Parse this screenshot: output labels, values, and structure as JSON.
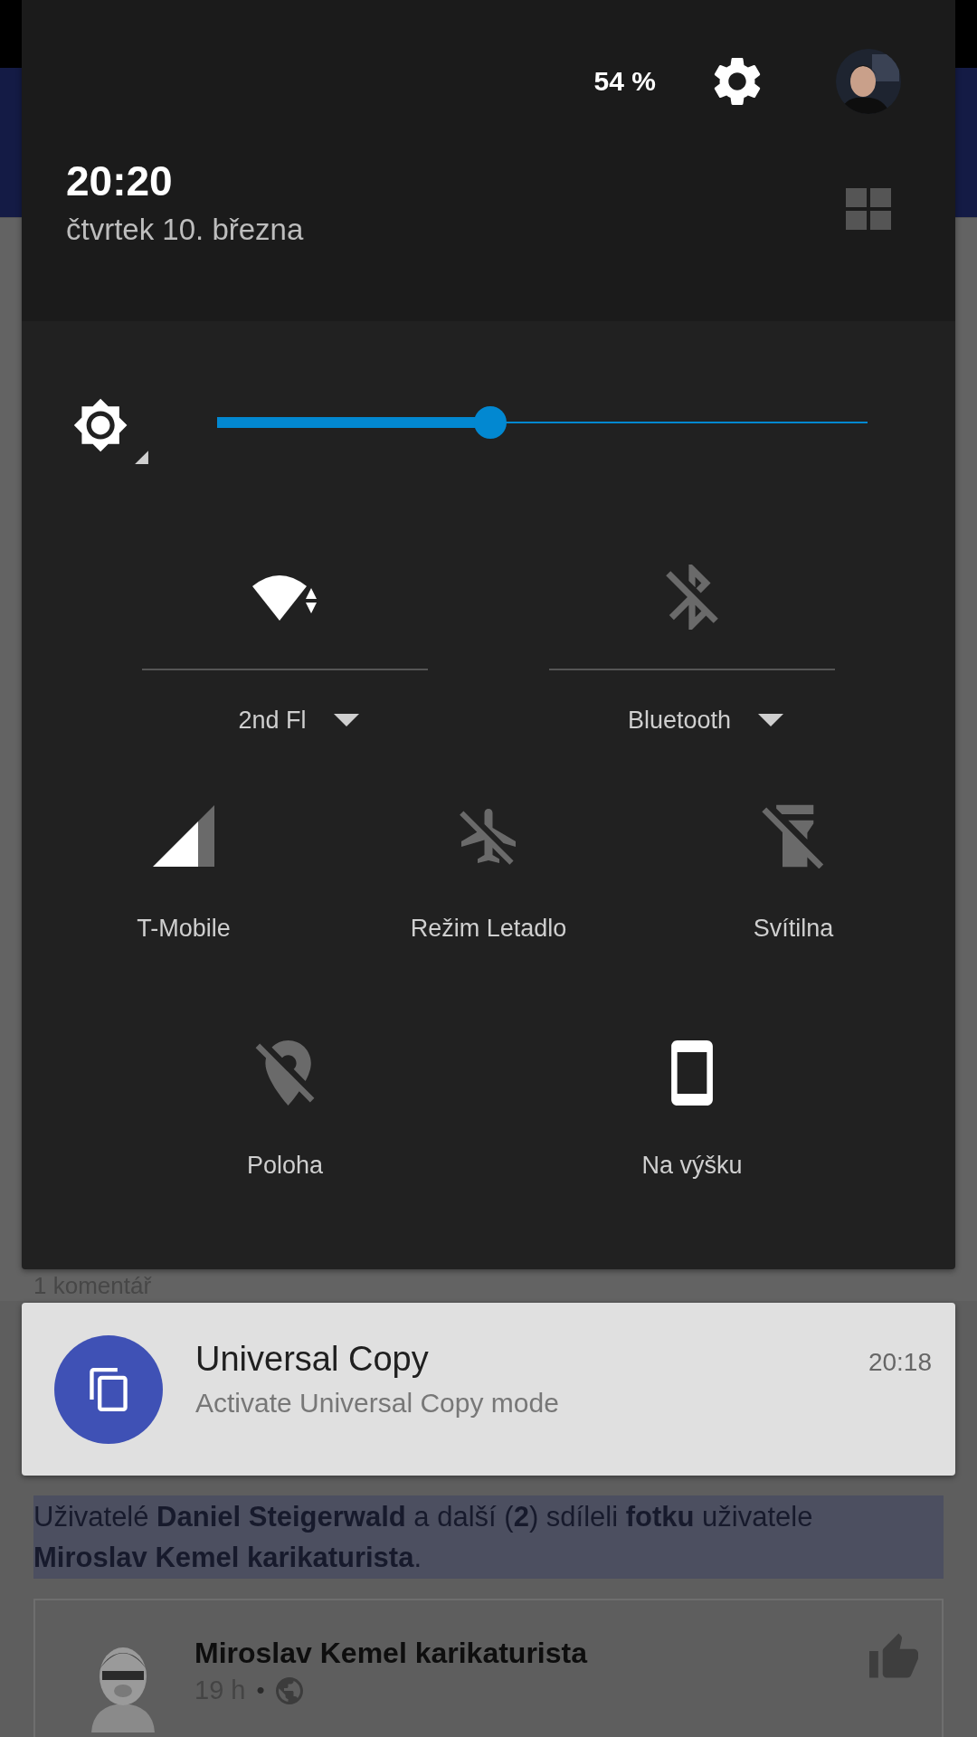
{
  "header": {
    "battery": "54 %",
    "time": "20:20",
    "date": "čtvrtek 10. března"
  },
  "brightness": {
    "level": 0.42
  },
  "rows": [
    {
      "tiles": [
        {
          "kind": "wifi",
          "label": "2nd Fl",
          "on": true,
          "dropdown": true
        },
        {
          "kind": "bluetooth",
          "label": "Bluetooth",
          "on": false,
          "dropdown": true
        }
      ]
    },
    {
      "tiles": [
        {
          "kind": "signal",
          "label": "T-Mobile",
          "on": true,
          "dropdown": false
        },
        {
          "kind": "airplane",
          "label": "Režim Letadlo",
          "on": false,
          "dropdown": false
        },
        {
          "kind": "flashlight",
          "label": "Svítilna",
          "on": false,
          "dropdown": false
        }
      ]
    },
    {
      "tiles": [
        {
          "kind": "location",
          "label": "Poloha",
          "on": false,
          "dropdown": false
        },
        {
          "kind": "rotation",
          "label": "Na výšku",
          "on": true,
          "dropdown": false
        }
      ]
    }
  ],
  "notification": {
    "title": "Universal Copy",
    "text": "Activate Universal Copy mode",
    "time": "20:18"
  },
  "page": {
    "comments": "1 komentář",
    "story": "Uživatelé **Daniel Steigerwald** a další (**2**) sdíleli **fotku** uživatele **Miroslav Kemel karikaturista**.",
    "author": "Miroslav Kemel karikaturista",
    "age": "19 h",
    "separator": "•"
  }
}
